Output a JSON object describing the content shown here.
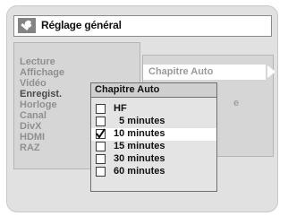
{
  "title": "Réglage général",
  "main_menu": [
    {
      "label": "Lecture",
      "selected": false
    },
    {
      "label": "Affichage",
      "selected": false
    },
    {
      "label": "Vidéo",
      "selected": false
    },
    {
      "label": "Enregist.",
      "selected": true
    },
    {
      "label": "Horloge",
      "selected": false
    },
    {
      "label": "Canal",
      "selected": false
    },
    {
      "label": "DivX",
      "selected": false
    },
    {
      "label": "HDMI",
      "selected": false
    },
    {
      "label": "RAZ",
      "selected": false
    }
  ],
  "submenu": {
    "option": "Chapitre Auto",
    "hidden_fragment": "e"
  },
  "popup": {
    "title": "Chapitre Auto",
    "options": [
      {
        "label": "HF",
        "checked": false,
        "selected": false
      },
      {
        "label": "  5 minutes",
        "checked": false,
        "selected": false
      },
      {
        "label": "10 minutes",
        "checked": true,
        "selected": true
      },
      {
        "label": "15 minutes",
        "checked": false,
        "selected": false
      },
      {
        "label": "30 minutes",
        "checked": false,
        "selected": false
      },
      {
        "label": "60 minutes",
        "checked": false,
        "selected": false
      }
    ]
  },
  "icons": {
    "title_icon": "wrench-icon",
    "submenu_arrow": "arrow-right-icon"
  },
  "colors": {
    "background": "#e1e1e1",
    "panel": "#d6d6d6",
    "highlight": "#ffffff",
    "text": "#111111",
    "muted_text": "#909090"
  }
}
